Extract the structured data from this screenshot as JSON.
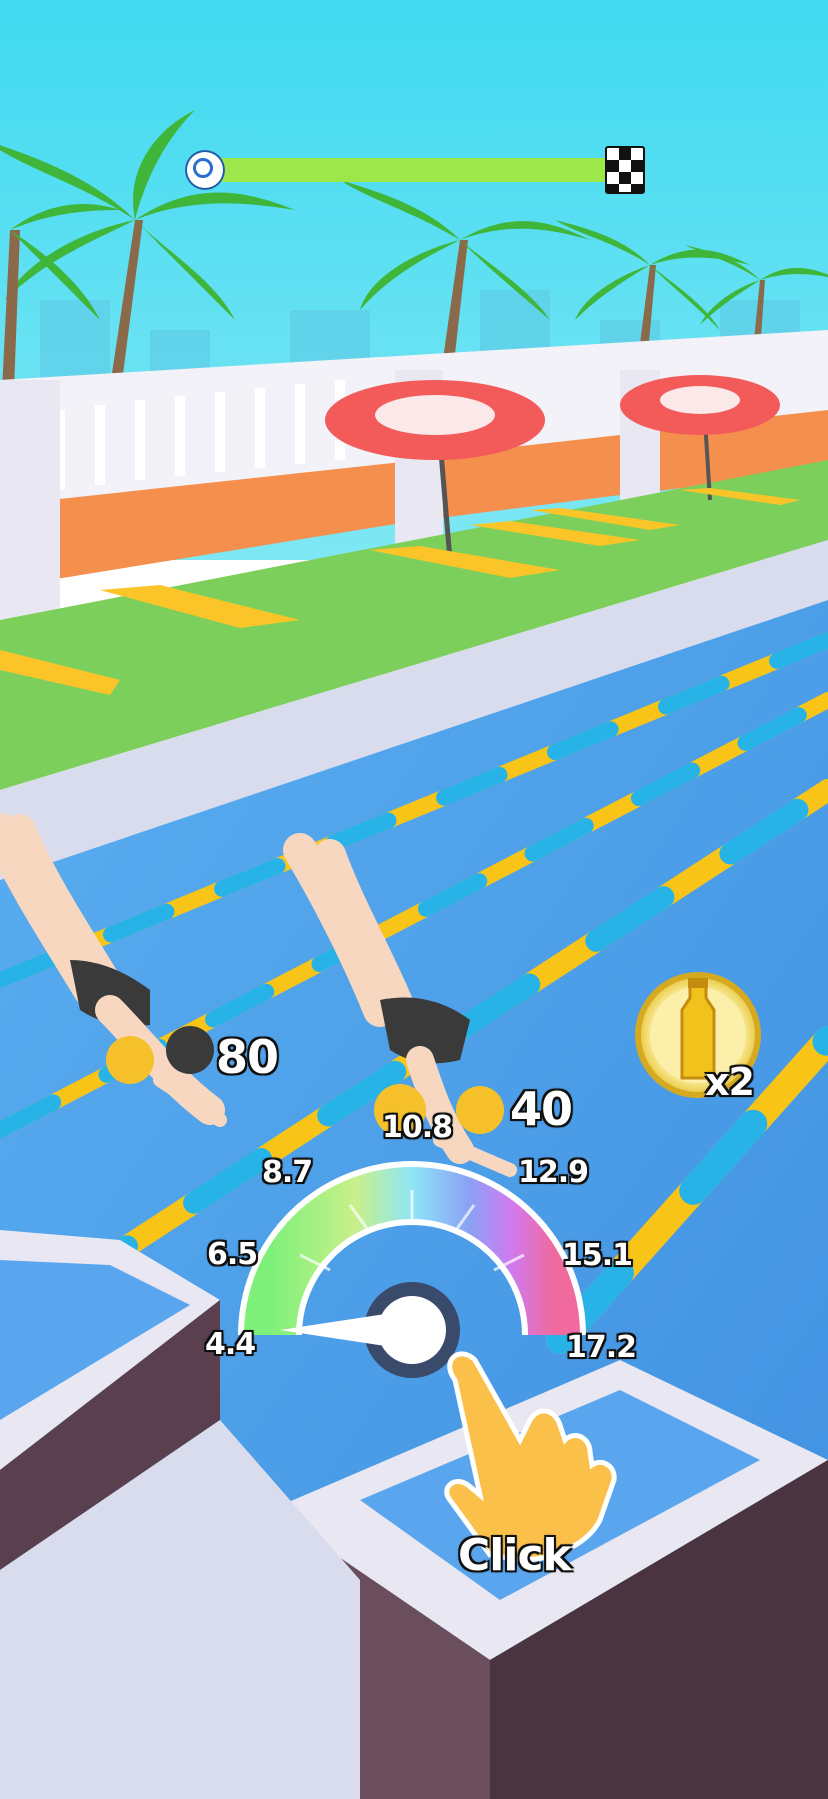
{
  "level_progress": {
    "fraction": 0.0,
    "start_icon": "target-icon",
    "finish_icon": "checkered-flag-icon"
  },
  "players": [
    {
      "score": "80"
    },
    {
      "score": "40"
    }
  ],
  "speed_gauge": {
    "ticks": [
      "4.4",
      "6.5",
      "8.7",
      "10.8",
      "12.9",
      "15.1",
      "17.2"
    ],
    "needle_value": 4.4
  },
  "powerup": {
    "icon": "energy-drink-bottle-icon",
    "multiplier": "x2"
  },
  "tutorial": {
    "hand_icon": "tap-hand-icon",
    "label": "Click"
  },
  "colors": {
    "sky": "#4ee0f2",
    "pool": "#4a9de8",
    "lane_yellow": "#f9c418",
    "lane_blue": "#27b3e8",
    "progress": "#8de24a"
  }
}
